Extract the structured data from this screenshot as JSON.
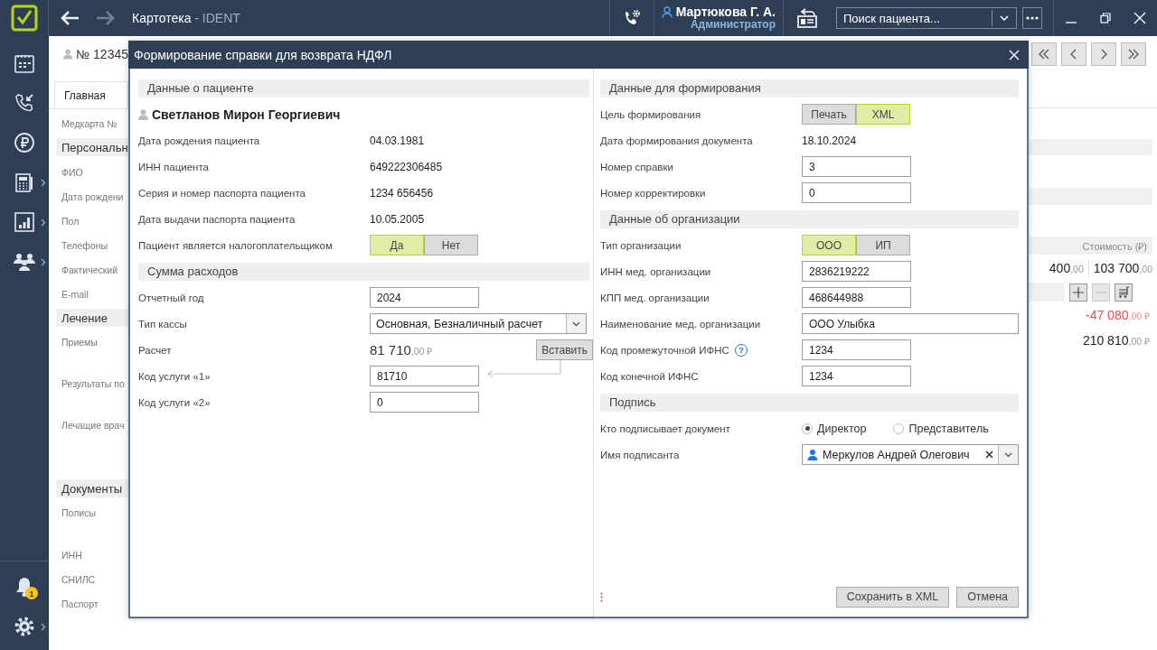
{
  "topbar": {
    "title": "Картотека",
    "app": "- IDENT",
    "back": {
      "disabled": false
    },
    "forward": {
      "disabled": true
    },
    "user": {
      "name": "Мартюкова Г. А.",
      "role": "Администратор"
    },
    "search": {
      "placeholder": "Поиск пациента..."
    }
  },
  "sidebar": {
    "items": [
      {
        "kind": "calendar",
        "submenu": false
      },
      {
        "kind": "calls",
        "submenu": false
      },
      {
        "kind": "payments",
        "submenu": false
      },
      {
        "kind": "cashbox",
        "submenu": true
      },
      {
        "kind": "reports",
        "submenu": true
      },
      {
        "kind": "staff",
        "submenu": true
      }
    ],
    "bottom": [
      {
        "kind": "notifications",
        "badge": "1",
        "submenu": false
      },
      {
        "kind": "settings",
        "submenu": true
      }
    ]
  },
  "record": {
    "number": "№ 12345",
    "tabs": [
      {
        "label": "Главная",
        "selected": true
      }
    ],
    "fields": [
      {
        "kind": "field",
        "label": "Медкарта №"
      },
      {
        "kind": "section",
        "label": "Персональн"
      },
      {
        "kind": "field",
        "label": "ФИО"
      },
      {
        "kind": "field",
        "label": "Дата рождени"
      },
      {
        "kind": "field",
        "label": "Пол"
      },
      {
        "kind": "field",
        "label": "Телефоны"
      },
      {
        "kind": "field",
        "label": "Фактический"
      },
      {
        "kind": "field",
        "label": "E-mail"
      },
      {
        "kind": "section",
        "label": "Лечение"
      },
      {
        "kind": "tall",
        "label": "Приемы"
      },
      {
        "kind": "tall",
        "label": "Результаты по"
      },
      {
        "kind": "taller",
        "label": "Лечащие врач"
      },
      {
        "kind": "section",
        "label": "Документы"
      },
      {
        "kind": "tall",
        "label": "Полисы"
      },
      {
        "kind": "field",
        "label": "ИНН"
      },
      {
        "kind": "field",
        "label": "СНИЛС"
      },
      {
        "kind": "field",
        "label": "Паспорт"
      }
    ]
  },
  "summary": {
    "column": "Стоимость (₽)",
    "amounts": [
      {
        "main": "400",
        "fraction": ",00"
      },
      {
        "main": "103 700",
        "fraction": ",00"
      }
    ],
    "discount": {
      "main": "-47 080",
      "fraction": ",00 ₽"
    },
    "total": {
      "main": "210 810",
      "fraction": ",00 ₽"
    }
  },
  "dialog": {
    "title": "Формирование справки для возврата НДФЛ",
    "left": [
      {
        "title": "Данные о пациенте",
        "rows": [
          {
            "kind": "person",
            "value": "Светланов Мирон Георгиевич"
          },
          {
            "kind": "text",
            "label": "Дата рождения пациента",
            "value": "04.03.1981"
          },
          {
            "kind": "text",
            "label": "ИНН пациента",
            "value": "649222306485"
          },
          {
            "kind": "text",
            "label": "Серия и номер паспорта пациента",
            "value": "1234 656456"
          },
          {
            "kind": "text",
            "label": "Дата выдачи паспорта пациента",
            "value": "10.05.2005"
          },
          {
            "kind": "toggle",
            "label": "Пациент является налогоплательщиком",
            "options": [
              {
                "label": "Да",
                "selected": true
              },
              {
                "label": "Нет",
                "selected": false
              }
            ]
          }
        ]
      },
      {
        "title": "Сумма расходов",
        "rows": [
          {
            "kind": "input",
            "label": "Отчетный год",
            "value": "2024"
          },
          {
            "kind": "select",
            "label": "Тип кассы",
            "value": "Основная, Безналичный расчет"
          },
          {
            "kind": "amount",
            "label": "Расчет",
            "main": "81 710",
            "fraction": ",00 ₽",
            "button": "Вставить"
          },
          {
            "kind": "input",
            "label": "Код услуги «1»",
            "value": "81710"
          },
          {
            "kind": "input",
            "label": "Код услуги «2»",
            "value": "0"
          }
        ]
      }
    ],
    "right": [
      {
        "title": "Данные для формирования",
        "rows": [
          {
            "kind": "toggle",
            "label": "Цель формирования",
            "options": [
              {
                "label": "Печать",
                "selected": false
              },
              {
                "label": "XML",
                "selected": true
              }
            ]
          },
          {
            "kind": "text",
            "label": "Дата формирования документа",
            "value": "18.10.2024"
          },
          {
            "kind": "input",
            "label": "Номер справки",
            "value": "3"
          },
          {
            "kind": "input",
            "label": "Номер корректировки",
            "value": "0"
          }
        ]
      },
      {
        "title": "Данные об организации",
        "rows": [
          {
            "kind": "toggle",
            "label": "Тип организации",
            "options": [
              {
                "label": "ООО",
                "selected": true
              },
              {
                "label": "ИП",
                "selected": false
              }
            ]
          },
          {
            "kind": "input",
            "label": "ИНН мед. организации",
            "value": "2836219222"
          },
          {
            "kind": "input",
            "label": "КПП мед. организации",
            "value": "468644988"
          },
          {
            "kind": "wide-input",
            "label": "Наименование мед. организации",
            "value": "ООО Улыбка"
          },
          {
            "kind": "input",
            "label": "Код промежуточной ИФНС",
            "help": "?",
            "value": "1234"
          },
          {
            "kind": "input",
            "label": "Код конечной ИФНС",
            "value": "1234"
          }
        ]
      },
      {
        "title": "Подпись",
        "rows": [
          {
            "kind": "radio",
            "label": "Кто подписывает документ",
            "options": [
              {
                "label": "Директор",
                "selected": true
              },
              {
                "label": "Представитель",
                "selected": false
              }
            ]
          },
          {
            "kind": "person-select",
            "label": "Имя подписанта",
            "value": "Меркулов Андрей Олегович"
          }
        ]
      }
    ],
    "buttons": [
      {
        "label": "Сохранить в XML"
      },
      {
        "label": "Отмена"
      }
    ]
  }
}
